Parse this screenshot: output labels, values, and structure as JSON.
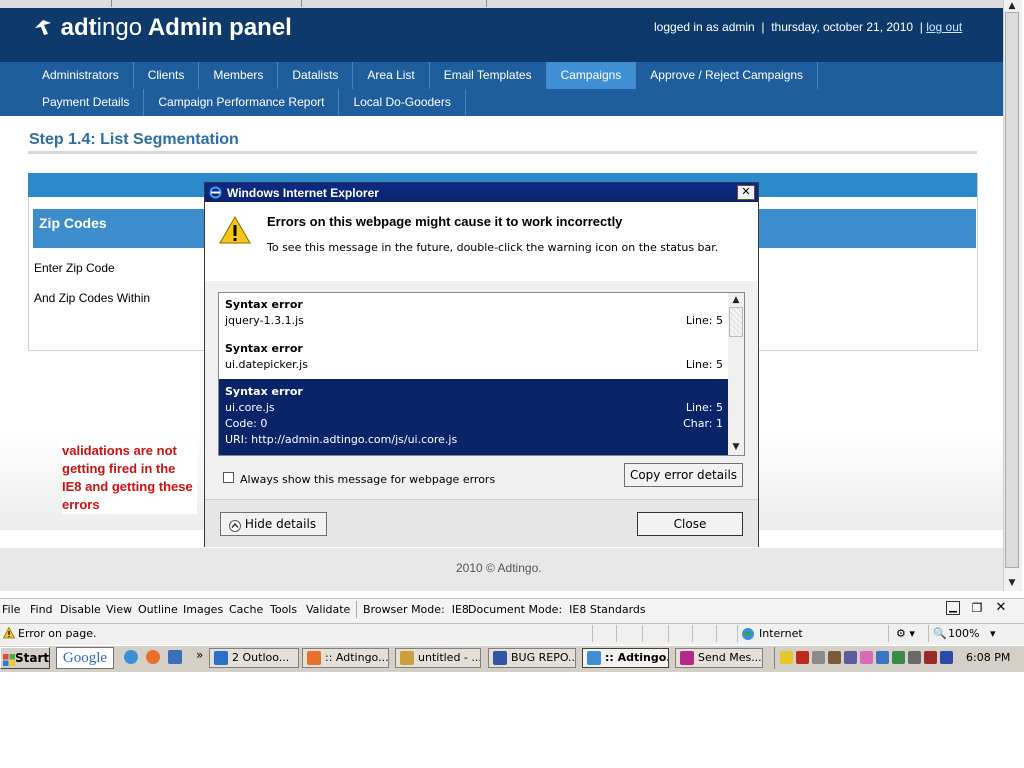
{
  "colors": {
    "header_bg": "#0e3a6b",
    "nav_bg": "#1f5e9c",
    "nav_active": "#3e8fd4",
    "accent": "#2b8acb",
    "note_red": "#d01010",
    "dialog_title": "#0a246a"
  },
  "header": {
    "logo_bold": "adt",
    "logo_thin": "ingo",
    "logo_rest": " Admin panel",
    "user_info": "logged in as admin  |  thursday, october 21, 2010  |",
    "logout": "log out"
  },
  "nav": {
    "row1": [
      "Administrators",
      "Clients",
      "Members",
      "Datalists",
      "Area List",
      "Email Templates",
      "Campaigns",
      "Approve / Reject Campaigns"
    ],
    "row2": [
      "Payment Details",
      "Campaign Performance Report",
      "Local Do-Gooders"
    ],
    "active": "Campaigns"
  },
  "page": {
    "step_title": "Step 1.4: List Segmentation",
    "zip_title": "Zip Codes",
    "label_enter_zip": "Enter Zip Code",
    "label_within": "And Zip Codes Within",
    "note": "validations are not getting fired in the IE8 and getting these errors",
    "footer": "2010 © Adtingo."
  },
  "dialog": {
    "title": "Windows Internet Explorer",
    "heading": "Errors on this webpage might cause it to work incorrectly",
    "sub": "To see this message in the future, double-click the warning icon on the status bar.",
    "errors": [
      {
        "title": "Syntax error",
        "file": "jquery-1.3.1.js",
        "line": "Line: 5"
      },
      {
        "title": "Syntax error",
        "file": "ui.datepicker.js",
        "line": "Line: 5"
      },
      {
        "title": "Syntax error",
        "file": "ui.core.js",
        "line": "Line: 5",
        "code": "Code: 0",
        "char": "Char: 1",
        "uri": "URI: http://admin.adtingo.com/js/ui.core.js"
      }
    ],
    "checkbox_label": "Always show this message for webpage errors",
    "copy_button": "Copy error details",
    "hide_button": "Hide details",
    "close_button": "Close"
  },
  "devtoolbar": {
    "menus": [
      "File",
      "Find",
      "Disable",
      "View",
      "Outline",
      "Images",
      "Cache",
      "Tools",
      "Validate"
    ],
    "browser_mode": "Browser Mode:  IE8",
    "document_mode": "Document Mode:  IE8 Standards"
  },
  "statusbar": {
    "message": "Error on page.",
    "zone": "Internet",
    "zoom": "100%"
  },
  "taskbar": {
    "start": "Start",
    "google": "Google",
    "chevron": "»",
    "tasks": [
      "2 Outloo...",
      ":: Adtingo...",
      "untitled - ...",
      "BUG REPO...",
      ":: Adtingo...",
      "Send Mes..."
    ],
    "active_index": 4,
    "clock": "6:08 PM"
  }
}
